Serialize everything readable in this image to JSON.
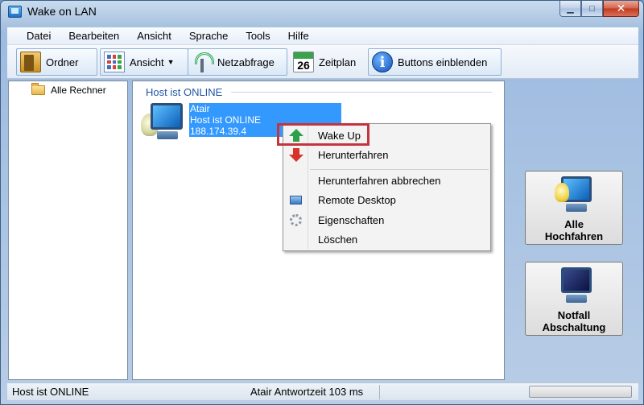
{
  "window": {
    "title": "Wake on LAN"
  },
  "menu": [
    "Datei",
    "Bearbeiten",
    "Ansicht",
    "Sprache",
    "Tools",
    "Hilfe"
  ],
  "toolbar": {
    "ordner": "Ordner",
    "ansicht": "Ansicht",
    "netzabfrage": "Netzabfrage",
    "zeitplan": "Zeitplan",
    "calendar_day": "26",
    "buttons_einblenden": "Buttons einblenden"
  },
  "tree": {
    "root": "Alle Rechner"
  },
  "main": {
    "group_header": "Host ist ONLINE",
    "host": {
      "name": "Atair",
      "status": "Host ist ONLINE",
      "ip": "188.174.39.4"
    }
  },
  "context_menu": {
    "items": [
      "Wake Up",
      "Herunterfahren",
      "Herunterfahren abbrechen",
      "Remote Desktop",
      "Eigenschaften",
      "Löschen"
    ]
  },
  "side_buttons": {
    "hochfahren_line1": "Alle",
    "hochfahren_line2": "Hochfahren",
    "notfall_line1": "Notfall",
    "notfall_line2": "Abschaltung"
  },
  "status": {
    "left": "Host ist ONLINE",
    "middle": "Atair Antwortzeit 103 ms"
  },
  "colors": {
    "selection": "#3399ff",
    "group_header": "#1f56a3",
    "highlight": "#c3343e"
  }
}
